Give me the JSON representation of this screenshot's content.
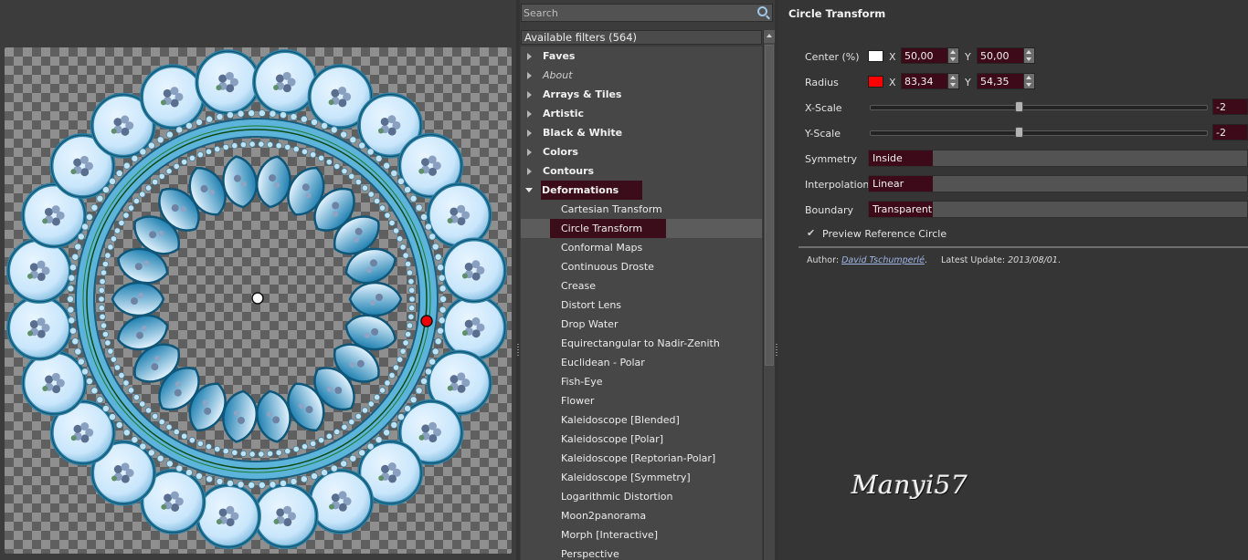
{
  "search": {
    "placeholder": "Search"
  },
  "filters": {
    "header": "Available filters (564)",
    "rows": [
      {
        "label": "Faves",
        "kind": "category"
      },
      {
        "label": "About",
        "kind": "italic"
      },
      {
        "label": "Arrays & Tiles",
        "kind": "category"
      },
      {
        "label": "Artistic",
        "kind": "category"
      },
      {
        "label": "Black & White",
        "kind": "category"
      },
      {
        "label": "Colors",
        "kind": "category"
      },
      {
        "label": "Contours",
        "kind": "category"
      },
      {
        "label": "Deformations",
        "kind": "open"
      },
      {
        "label": "Cartesian Transform",
        "kind": "child"
      },
      {
        "label": "Circle Transform",
        "kind": "selected"
      },
      {
        "label": "Conformal Maps",
        "kind": "child"
      },
      {
        "label": "Continuous Droste",
        "kind": "child"
      },
      {
        "label": "Crease",
        "kind": "child"
      },
      {
        "label": "Distort Lens",
        "kind": "child"
      },
      {
        "label": "Drop Water",
        "kind": "child"
      },
      {
        "label": "Equirectangular to Nadir-Zenith",
        "kind": "child"
      },
      {
        "label": "Euclidean - Polar",
        "kind": "child"
      },
      {
        "label": "Fish-Eye",
        "kind": "child"
      },
      {
        "label": "Flower",
        "kind": "child"
      },
      {
        "label": "Kaleidoscope [Blended]",
        "kind": "child"
      },
      {
        "label": "Kaleidoscope [Polar]",
        "kind": "child"
      },
      {
        "label": "Kaleidoscope [Reptorian-Polar]",
        "kind": "child"
      },
      {
        "label": "Kaleidoscope [Symmetry]",
        "kind": "child"
      },
      {
        "label": "Logarithmic Distortion",
        "kind": "child"
      },
      {
        "label": "Moon2panorama",
        "kind": "child"
      },
      {
        "label": "Morph [Interactive]",
        "kind": "child"
      },
      {
        "label": "Perspective",
        "kind": "child"
      }
    ]
  },
  "params": {
    "title": "Circle Transform",
    "center": {
      "label": "Center (%)",
      "color": "#ffffff",
      "x_axis": "X",
      "x": "50,00",
      "y_axis": "Y",
      "y": "50,00"
    },
    "radius": {
      "label": "Radius",
      "color": "#ff0000",
      "x_axis": "X",
      "x": "83,34",
      "y_axis": "Y",
      "y": "54,35"
    },
    "xscale": {
      "label": "X-Scale",
      "value": "-2",
      "fraction": 0.44
    },
    "yscale": {
      "label": "Y-Scale",
      "value": "-2",
      "fraction": 0.44
    },
    "symmetry": {
      "label": "Symmetry",
      "value": "Inside"
    },
    "interpolation": {
      "label": "Interpolation",
      "value": "Linear"
    },
    "boundary": {
      "label": "Boundary",
      "value": "Transparent"
    },
    "preview_circle": {
      "label": "Preview Reference Circle",
      "checked": true
    },
    "author": {
      "prefix": "Author:",
      "name": "David Tschumperlé",
      "update_label": "Latest Update:",
      "update": "2013/08/01"
    }
  },
  "signature": "Manyi57",
  "colors": {
    "selection": "#3b0d1a",
    "tile_light": "#c9e6fb",
    "tile_ring": "#2a7fa3"
  }
}
